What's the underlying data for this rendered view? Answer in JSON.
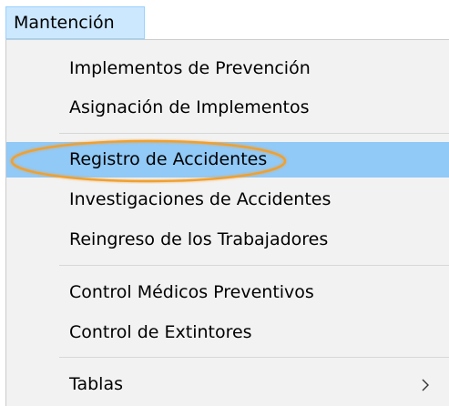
{
  "menu": {
    "title": "Mantención",
    "items": [
      {
        "label": "Implementos de Prevención"
      },
      {
        "label": "Asignación de Implementos"
      },
      {
        "label": "Registro de Accidentes"
      },
      {
        "label": "Investigaciones de Accidentes"
      },
      {
        "label": "Reingreso de los Trabajadores"
      },
      {
        "label": "Control Médicos Preventivos"
      },
      {
        "label": "Control de  Extintores"
      },
      {
        "label": "Tablas"
      }
    ]
  },
  "colors": {
    "menubar_active_bg": "#cce8ff",
    "highlight_bg": "#91c9f7",
    "menu_bg": "#f2f2f2",
    "annotation": "#f0a030"
  },
  "icons": {
    "submenu": "chevron-right-icon"
  }
}
